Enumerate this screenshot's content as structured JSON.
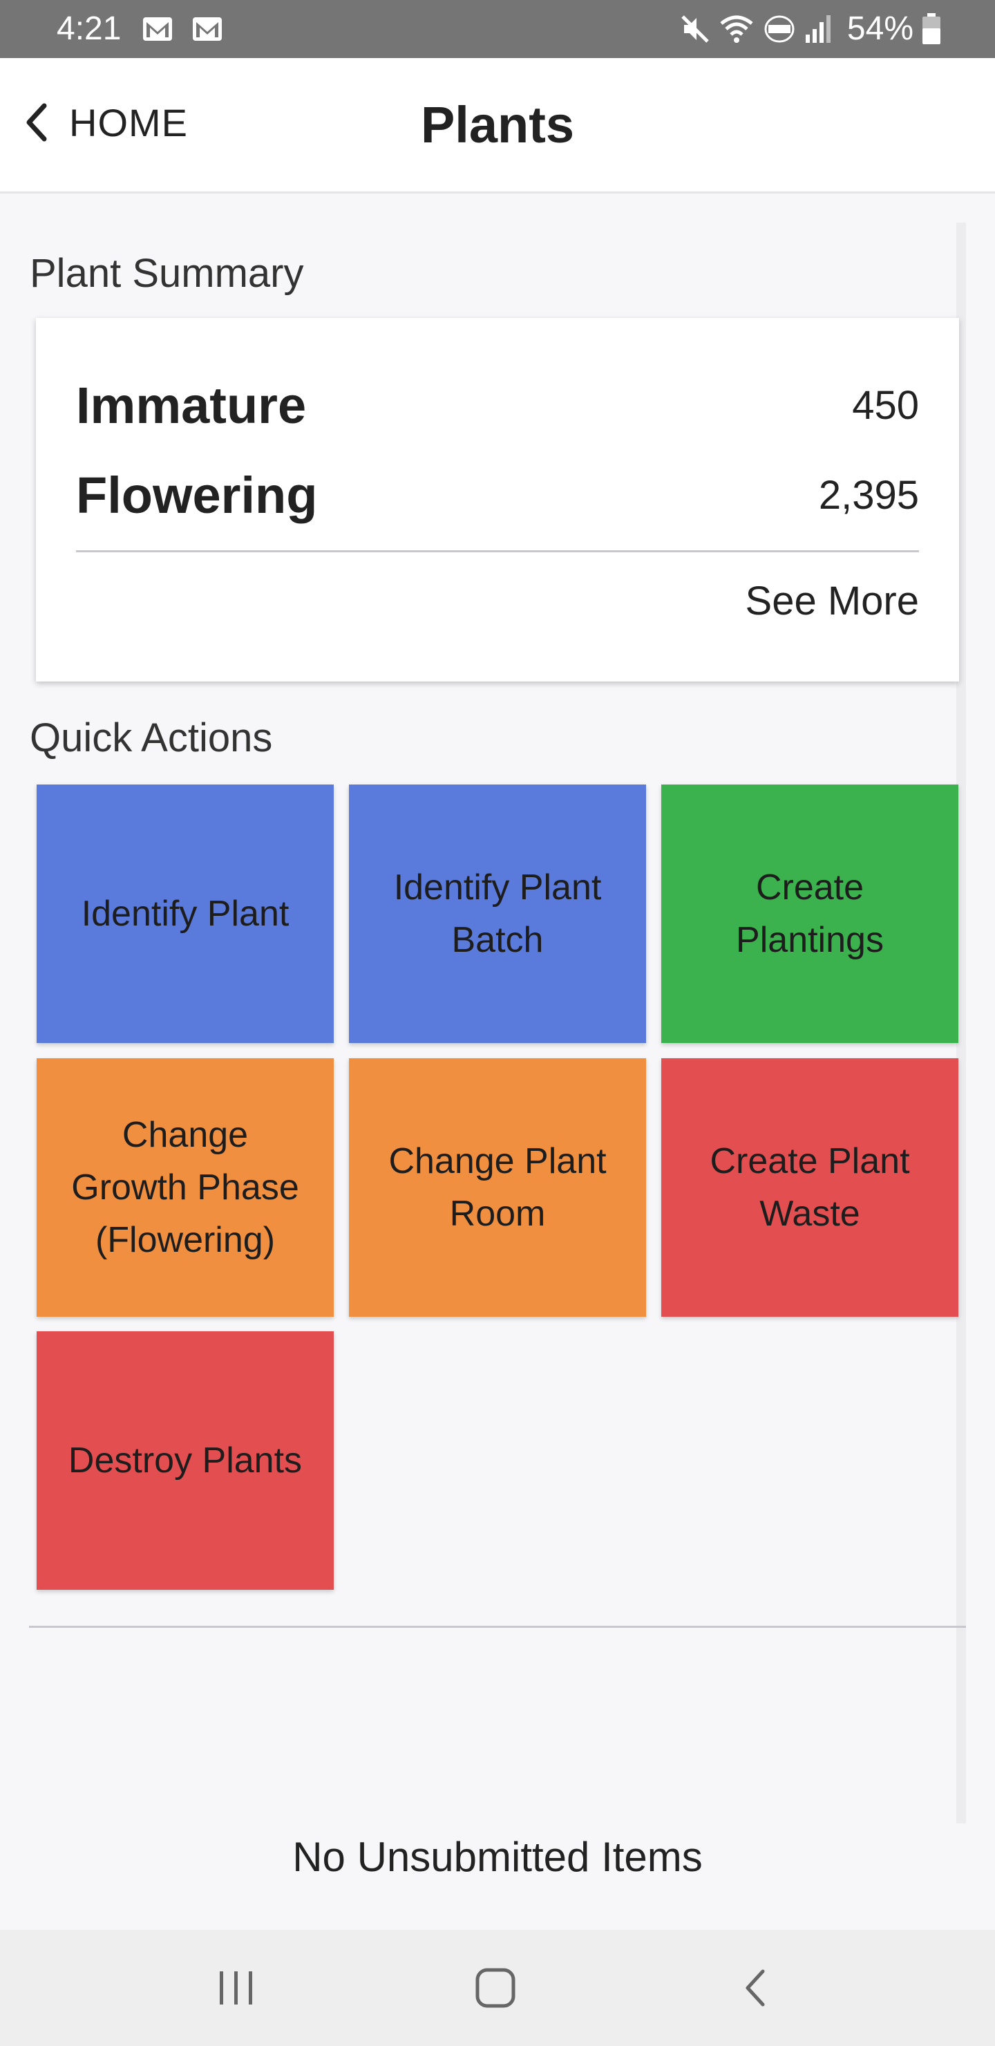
{
  "status_bar": {
    "time": "4:21",
    "battery_percent": "54%",
    "icons": [
      "gmail-icon",
      "mail-icon",
      "mute-icon",
      "wifi-icon",
      "volte-icon",
      "signal-icon",
      "battery-icon"
    ]
  },
  "app_bar": {
    "back_label": "HOME",
    "title": "Plants"
  },
  "plant_summary": {
    "heading": "Plant Summary",
    "rows": [
      {
        "label": "Immature",
        "value": "450"
      },
      {
        "label": "Flowering",
        "value": "2,395"
      }
    ],
    "see_more": "See More"
  },
  "quick_actions": {
    "heading": "Quick Actions",
    "tiles": [
      {
        "label": "Identify Plant",
        "color": "#5b7bdc"
      },
      {
        "label": "Identify Plant Batch",
        "color": "#5b7bdc"
      },
      {
        "label": "Create Plantings",
        "color": "#3cb24e"
      },
      {
        "label": "Change Growth Phase (Flowering)",
        "color": "#f18f40"
      },
      {
        "label": "Change Plant Room",
        "color": "#f18f40"
      },
      {
        "label": "Create Plant Waste",
        "color": "#e34f51"
      },
      {
        "label": "Destroy Plants",
        "color": "#e34f51"
      }
    ]
  },
  "footer": {
    "unsubmitted": "No Unsubmitted Items"
  },
  "nav_bar": {
    "icons": [
      "recent-apps-icon",
      "home-icon",
      "back-icon"
    ]
  }
}
